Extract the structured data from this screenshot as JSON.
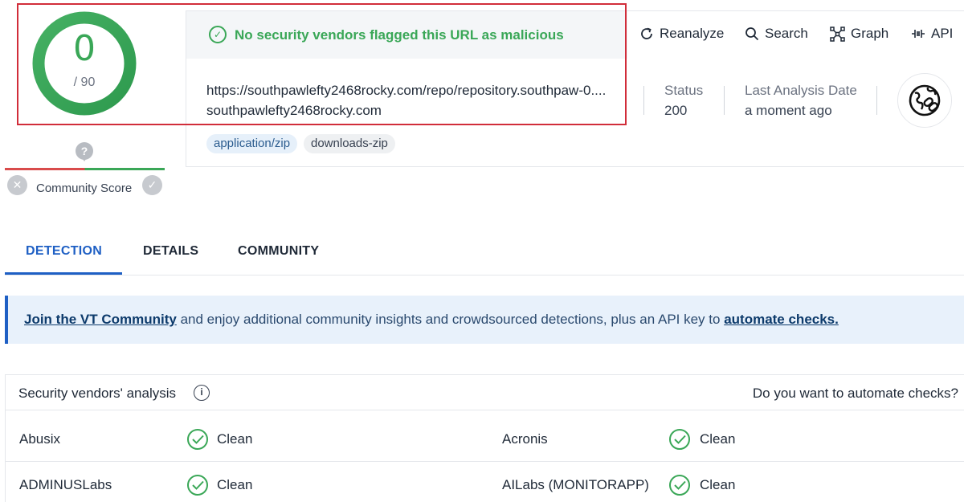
{
  "score": {
    "detections": "0",
    "total": "/ 90"
  },
  "community": {
    "label": "Community Score",
    "unknown_glyph": "?"
  },
  "banner": {
    "text": "No security vendors flagged this URL as malicious"
  },
  "target": {
    "url": "https://southpawlefty2468rocky.com/repo/repository.southpaw-0....",
    "domain": "southpawlefty2468rocky.com"
  },
  "status": {
    "label": "Status",
    "value": "200"
  },
  "last_analysis": {
    "label": "Last Analysis Date",
    "value": "a moment ago"
  },
  "tags": [
    "application/zip",
    "downloads-zip"
  ],
  "toolbar": {
    "reanalyze": "Reanalyze",
    "search": "Search",
    "graph": "Graph",
    "api": "API"
  },
  "tabs": [
    {
      "label": "DETECTION",
      "active": true
    },
    {
      "label": "DETAILS",
      "active": false
    },
    {
      "label": "COMMUNITY",
      "active": false
    }
  ],
  "notice": {
    "link1": "Join the VT Community",
    "middle": " and enjoy additional community insights and crowdsourced detections, plus an API key to ",
    "link2": "automate checks."
  },
  "vendors": {
    "title": "Security vendors' analysis",
    "cta": "Do you want to automate checks?",
    "rows": [
      {
        "left": {
          "name": "Abusix",
          "result": "Clean"
        },
        "right": {
          "name": "Acronis",
          "result": "Clean"
        }
      },
      {
        "left": {
          "name": "ADMINUSLabs",
          "result": "Clean"
        },
        "right": {
          "name": "AILabs (MONITORAPP)",
          "result": "Clean"
        }
      }
    ]
  },
  "colors": {
    "clean": "#3aa757",
    "accent": "#1e5fc4",
    "highlight": "#d12d3a",
    "malicious": "#d94b4b"
  }
}
